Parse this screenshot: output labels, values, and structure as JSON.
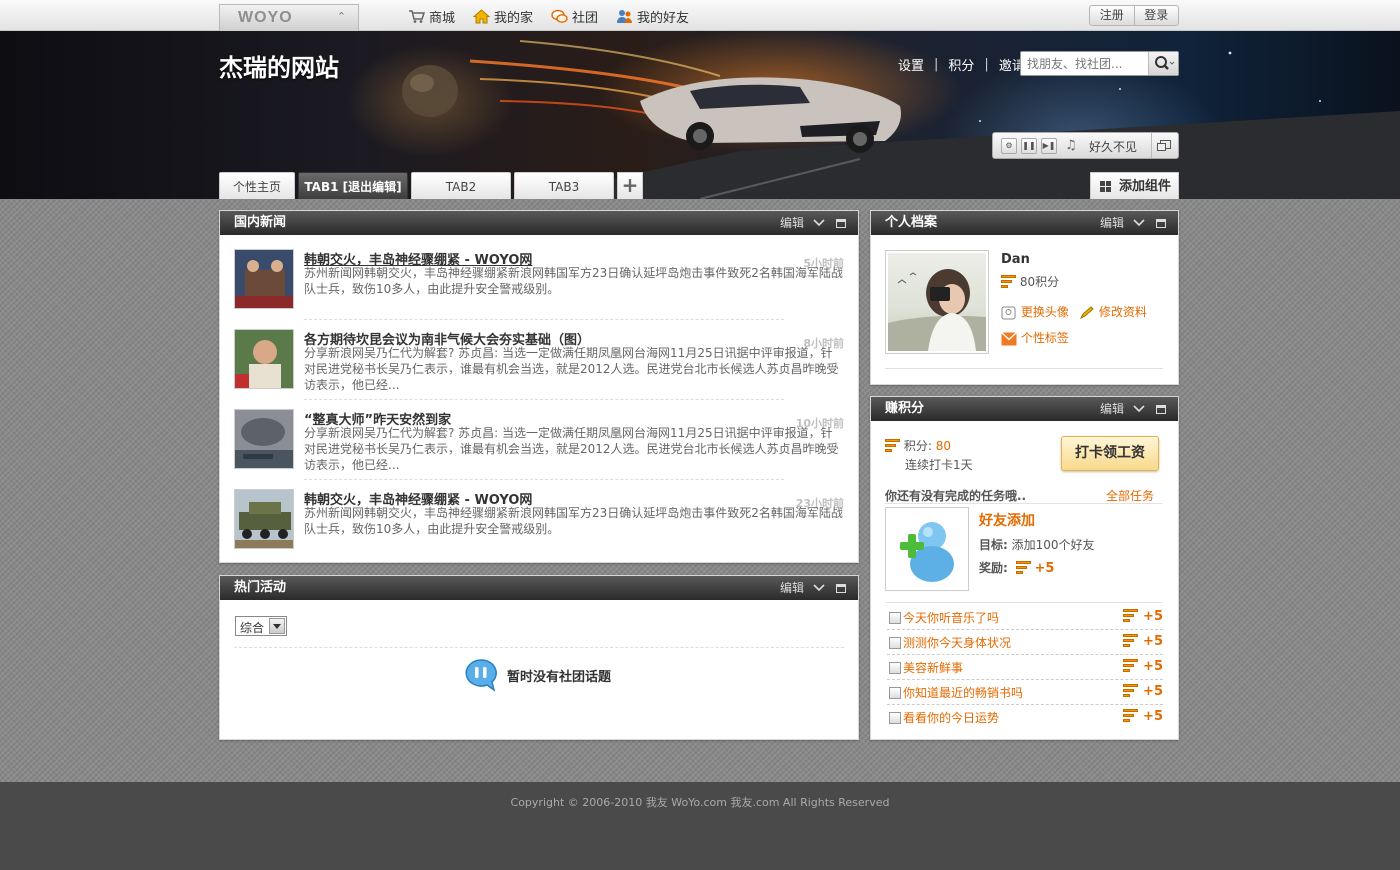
{
  "topbar": {
    "logo": "WOYO",
    "nav": [
      {
        "label": "商城",
        "icon": "cart-icon"
      },
      {
        "label": "我的家",
        "icon": "home-icon"
      },
      {
        "label": "社团",
        "icon": "chat-icon"
      },
      {
        "label": "我的好友",
        "icon": "friends-icon"
      }
    ],
    "register": "注册",
    "login": "登录"
  },
  "banner": {
    "site_title": "杰瑞的网站",
    "links": [
      "设置",
      "积分",
      "邀请"
    ],
    "search_placeholder": "找朋友、找社团...",
    "player_song": "好久不见",
    "tabs": [
      "个性主页",
      "TAB1 [退出编辑]",
      "TAB2",
      "TAB3"
    ],
    "add_widget": "添加组件"
  },
  "news": {
    "title": "国内新闻",
    "edit": "编辑",
    "items": [
      {
        "title": "韩朝交火，丰岛神经骤绷紧 - WOYO网",
        "time": "5小时前",
        "summary": "苏州新闻网韩朝交火，丰岛神经骤绷紧新浪网韩国军方23日确认延坪岛炮击事件致死2名韩国海军陆战队士兵，致伤10多人，由此提升安全警戒级别。"
      },
      {
        "title": "各方期待坎昆会议为南非气候大会夯实基础（图）",
        "time": "8小时前",
        "summary": "分享新浪网吴乃仁代为解套? 苏贞昌: 当选一定做满任期凤凰网台海网11月25日讯据中评审报道，针对民进党秘书长吴乃仁表示，谁最有机会当选，就是2012人选。民进党台北市长候选人苏贞昌昨晚受访表示，他已经..."
      },
      {
        "title": "“整真大师”昨天安然到家",
        "time": "10小时前",
        "summary": "分享新浪网吴乃仁代为解套? 苏贞昌: 当选一定做满任期凤凰网台海网11月25日讯据中评审报道，针对民进党秘书长吴乃仁表示，谁最有机会当选，就是2012人选。民进党台北市长候选人苏贞昌昨晚受访表示，他已经..."
      },
      {
        "title": "韩朝交火，丰岛神经骤绷紧 - WOYO网",
        "time": "23小时前",
        "summary": "苏州新闻网韩朝交火，丰岛神经骤绷紧新浪网韩国军方23日确认延坪岛炮击事件致死2名韩国海军陆战队士兵，致伤10多人，由此提升安全警戒级别。"
      }
    ]
  },
  "events": {
    "title": "热门活动",
    "edit": "编辑",
    "filter_value": "综合",
    "empty_text": "暂时没有社团话题"
  },
  "profile": {
    "title": "个人档案",
    "edit": "编辑",
    "name": "Dan",
    "points": "80积分",
    "change_avatar": "更换头像",
    "edit_info": "修改资料",
    "tags": "个性标签"
  },
  "earn": {
    "title": "赚积分",
    "edit": "编辑",
    "points_label": "积分:",
    "points_value": "80",
    "streak": "连续打卡1天",
    "checkin_button": "打卡领工资",
    "task_prompt": "你还有没有完成的任务哦..",
    "all_tasks": "全部任务",
    "featured": {
      "name": "好友添加",
      "target_label": "目标:",
      "target": "添加100个好友",
      "reward_label": "奖励:",
      "reward": "+5"
    },
    "tasks": [
      {
        "label": "今天你听音乐了吗",
        "reward": "+5"
      },
      {
        "label": "测测你今天身体状况",
        "reward": "+5"
      },
      {
        "label": "美容新鲜事",
        "reward": "+5"
      },
      {
        "label": "你知道最近的畅销书吗",
        "reward": "+5"
      },
      {
        "label": "看看你的今日运势",
        "reward": "+5"
      }
    ]
  },
  "footer": {
    "copyright": "Copyright © 2006-2010 我友 WoYo.com 我友.com All Rights Reserved"
  },
  "colors": {
    "accent_orange": "#e46a00",
    "header_dark": "#2a2a2a"
  }
}
